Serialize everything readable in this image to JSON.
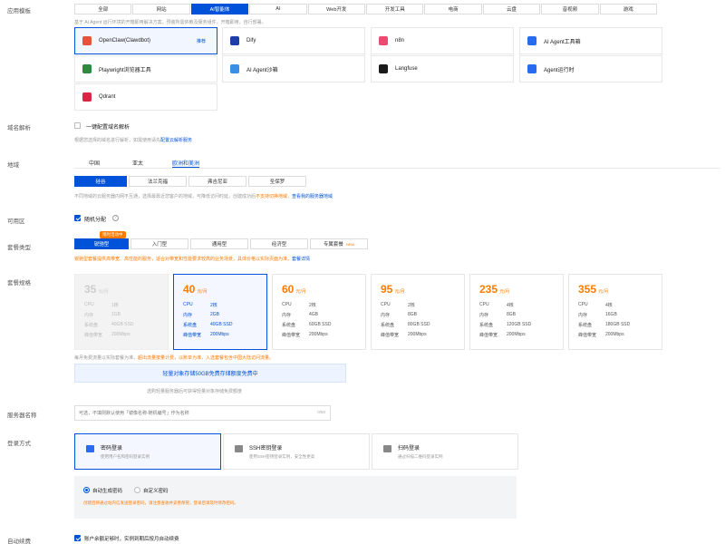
{
  "app_section": {
    "label": "应用模板",
    "tabs": [
      "全部",
      "网站",
      "AI智能体",
      "AI",
      "Web开发",
      "开发工具",
      "电商",
      "云盘",
      "音视频",
      "游戏"
    ],
    "hint": "基于 AI Agent 运行环境的开箱即用解决方案，预装所需依赖及服务组件，开箱即用，自行部署。",
    "cards": [
      {
        "label": "OpenClaw(Clawdbot)",
        "tag": "推荐",
        "icon_color": "#e8533d"
      },
      {
        "label": "Dify",
        "tag": "",
        "icon_color": "#1c3ea8"
      },
      {
        "label": "n8n",
        "tag": "",
        "icon_color": "#ea4b71"
      },
      {
        "label": "AI Agent工具箱",
        "tag": "",
        "icon_color": "#2a6af0"
      },
      {
        "label": "Playwright浏览器工具",
        "tag": "",
        "icon_color": "#2d8a3e"
      },
      {
        "label": "AI Agent沙箱",
        "tag": "",
        "icon_color": "#3a8ee6"
      },
      {
        "label": "Langfuse",
        "tag": "",
        "icon_color": "#1a1a1a"
      },
      {
        "label": "Agent运行时",
        "tag": "",
        "icon_color": "#2a6af0"
      },
      {
        "label": "Qdrant",
        "tag": "",
        "icon_color": "#dc2444"
      }
    ]
  },
  "domain_section": {
    "label": "域名解析",
    "checkbox_label": "一键配置域名解析",
    "hint": "根据您选择的域名进行解析，如需使用请先",
    "hint_link": "配置云解析服务"
  },
  "region_section": {
    "label": "地域",
    "tabs": [
      "中国",
      "亚太",
      "欧洲和美洲"
    ],
    "cities": [
      "硅谷",
      "法兰克福",
      "弗吉尼亚",
      "圣保罗"
    ],
    "hint": "不同地域的云服务器内网不互通，选择最靠近您客户的地域，可降低访问时延，创建成功后",
    "hint_warn": "不支持切换地域",
    "hint_link": "查看我的服务器地域"
  },
  "avail_section": {
    "label": "可用区",
    "checkbox_label": "随机分配"
  },
  "package_type": {
    "label": "套餐类型",
    "badge": "限时活动中",
    "tabs": [
      "锐驰型",
      "入门型",
      "通用型",
      "经济型",
      "专属套餐"
    ],
    "tab_extra": "NEW",
    "hint": "锐驰型套餐提供高带宽、高性能的服务，适合对带宽和性能要求较高的业务场景，具体价格以实际页面为准。",
    "hint_link": "套餐详情"
  },
  "package_spec": {
    "label": "套餐规格",
    "plans": [
      {
        "price": "35",
        "unit": "元/月",
        "cpu": "1核",
        "mem": "1GB",
        "disk": "40GB SSD",
        "bw": "200Mbps",
        "state": "disabled"
      },
      {
        "price": "40",
        "unit": "元/月",
        "cpu": "2核",
        "mem": "2GB",
        "disk": "40GB SSD",
        "bw": "200Mbps",
        "state": "selected"
      },
      {
        "price": "60",
        "unit": "元/月",
        "cpu": "2核",
        "mem": "4GB",
        "disk": "60GB SSD",
        "bw": "200Mbps",
        "state": "normal"
      },
      {
        "price": "95",
        "unit": "元/月",
        "cpu": "2核",
        "mem": "8GB",
        "disk": "80GB SSD",
        "bw": "200Mbps",
        "state": "normal"
      },
      {
        "price": "235",
        "unit": "元/月",
        "cpu": "4核",
        "mem": "8GB",
        "disk": "120GB SSD",
        "bw": "200Mbps",
        "state": "normal"
      },
      {
        "price": "355",
        "unit": "元/月",
        "cpu": "4核",
        "mem": "16GB",
        "disk": "180GB SSD",
        "bw": "200Mbps",
        "state": "normal"
      }
    ],
    "row_labels": {
      "cpu": "CPU",
      "mem": "内存",
      "disk": "系统盘",
      "bw": "峰值带宽"
    },
    "hint": "每月免费流量以实际套餐为准，",
    "hint_warn": "超出流量按量计费，以账单为准，",
    "hint_warn2": "入选套餐包含中国大陆访问流量。",
    "storage_link": "轻量对象存储50GB免费存储额度免费中",
    "storage_hint": "选购轻量服务器后可获得轻量对象存储免费额度"
  },
  "server_name": {
    "label": "服务器名称",
    "placeholder": "可选，不填则默认使用「镜像名称-随机编号」作为名称",
    "counter": "0/60"
  },
  "login_method": {
    "label": "登录方式",
    "options": [
      {
        "title": "密码登录",
        "desc": "使用用户名和密码登录实例",
        "icon_color": "#2a6af0",
        "state": "selected"
      },
      {
        "title": "SSH密钥登录",
        "desc": "使用SSH密钥登录实例，安全性更高",
        "icon_color": "#888",
        "state": "normal"
      },
      {
        "title": "扫码登录",
        "desc": "通过扫描二维码登录实例",
        "icon_color": "#888",
        "state": "normal"
      }
    ],
    "radios": [
      "自动生成密码",
      "自定义密码"
    ],
    "pwd_hint": "创建后将通过站内信发送登录密码，请注意查收并妥善保管，登录后请及时修改密码。"
  },
  "auto_renew": {
    "label": "自动续费",
    "checkbox_label": "账户余额足够时，实例到期后按月自动续费"
  }
}
